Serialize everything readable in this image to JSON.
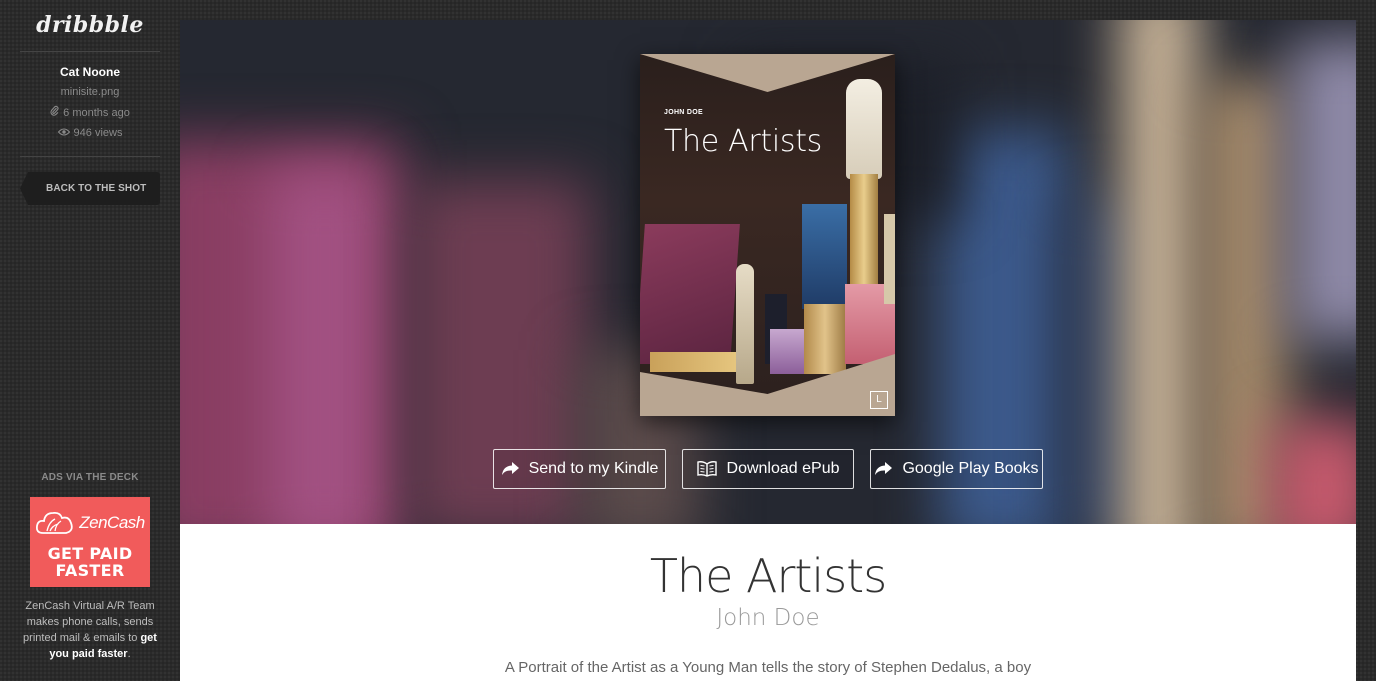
{
  "sidebar": {
    "logo": "dribbble",
    "author": "Cat Noone",
    "filename": "minisite.png",
    "time_ago": "6 months ago",
    "views": "946 views",
    "back_button": "BACK TO THE SHOT",
    "ads_heading": "ADS VIA THE DECK",
    "ad": {
      "brand": "ZenCash",
      "cta_line1": "GET PAID",
      "cta_line2": "FASTER",
      "copy_text": "ZenCash Virtual A/R Team makes phone calls, sends printed mail & emails to ",
      "copy_link": "get you paid faster",
      "copy_end": ".",
      "bg_color": "#f15b5b"
    }
  },
  "book": {
    "author": "JOHN DOE",
    "title": "The Artists",
    "publisher_mark": "L"
  },
  "actions": {
    "kindle": "Send to my Kindle",
    "epub": "Download ePub",
    "google": "Google Play Books"
  },
  "details": {
    "title": "The Artists",
    "author": "John Doe",
    "description": "A Portrait of the Artist as a Young Man tells the story of Stephen Dedalus, a boy"
  },
  "icons": {
    "paperclip": "paperclip-icon",
    "eye": "eye-icon",
    "share": "share-arrow-icon",
    "book": "open-book-icon"
  }
}
